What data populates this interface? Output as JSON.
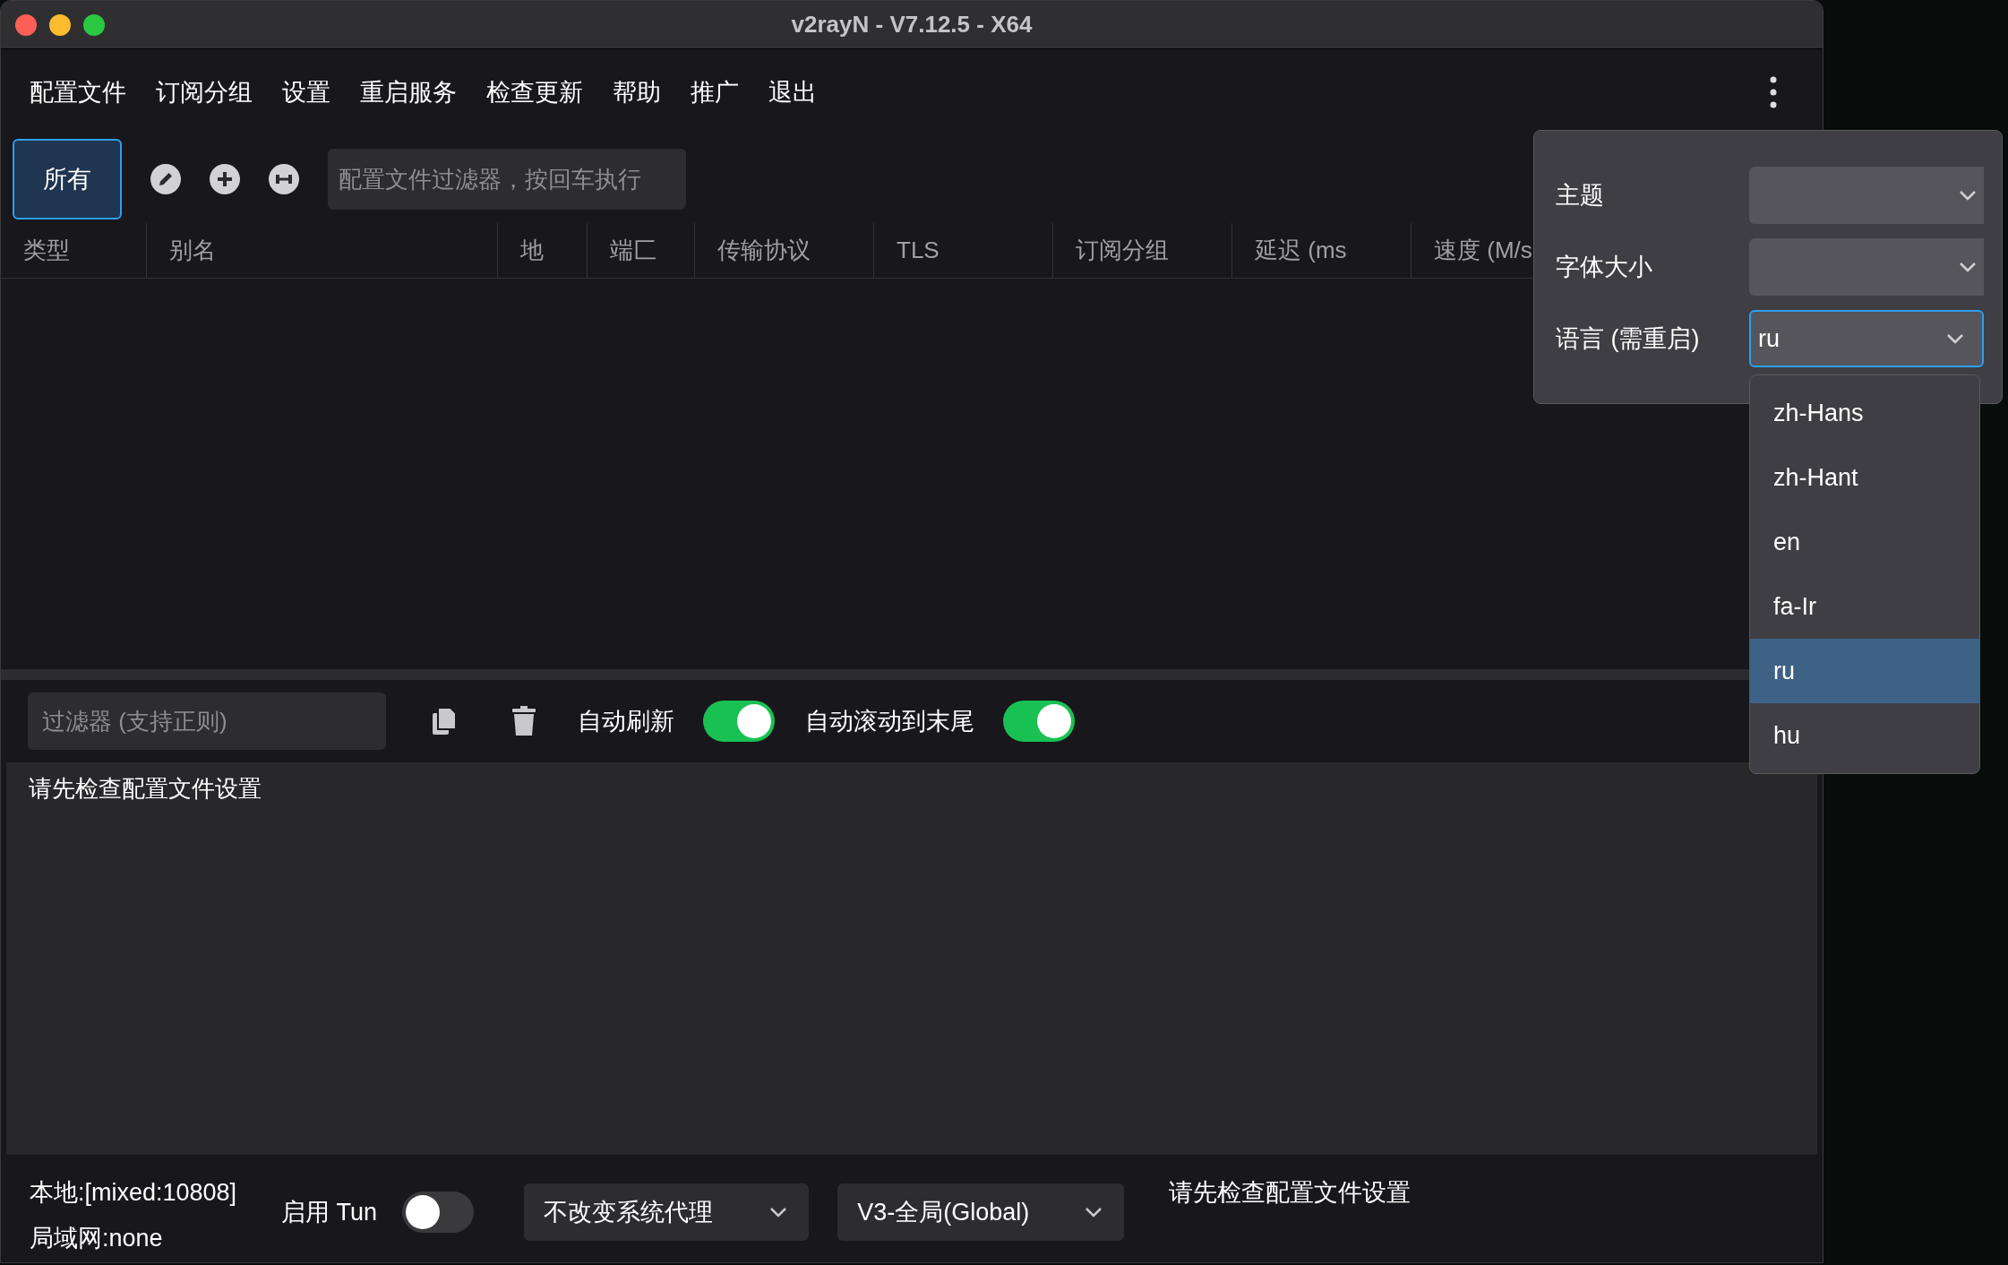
{
  "window": {
    "title": "v2rayN - V7.12.5 - X64"
  },
  "menu": [
    "配置文件",
    "订阅分组",
    "设置",
    "重启服务",
    "检查更新",
    "帮助",
    "推广",
    "退出"
  ],
  "toolbar": {
    "groups": [
      {
        "label": "所有",
        "selected": true
      }
    ],
    "filter": {
      "placeholder": "配置文件过滤器，按回车执行"
    }
  },
  "table": {
    "columns": [
      "类型",
      "别名",
      "地",
      "端匚",
      "传输协议",
      "TLS",
      "订阅分组",
      "延迟 (ms",
      "速度 (M/s"
    ]
  },
  "log_toolbar": {
    "filter": {
      "placeholder": "过滤器 (支持正则)"
    },
    "toggles": [
      {
        "label": "自动刷新",
        "on": true
      },
      {
        "label": "自动滚动到末尾",
        "on": true
      }
    ]
  },
  "log": {
    "text": "请先检查配置文件设置"
  },
  "status_bar": {
    "local": "本地:[mixed:10808]",
    "lan": "局域网:none",
    "tun": {
      "label": "启用 Tun",
      "on": false
    },
    "selects": [
      "不改变系统代理",
      "V3-全局(Global)"
    ],
    "message": "请先检查配置文件设置"
  },
  "settings_popup": {
    "rows": [
      {
        "label": "主题",
        "value": "",
        "focused": false
      },
      {
        "label": "字体大小",
        "value": "",
        "focused": false
      },
      {
        "label": "语言 (需重启)",
        "value": "ru",
        "focused": true
      }
    ],
    "options": [
      {
        "label": "zh-Hans",
        "selected": false
      },
      {
        "label": "zh-Hant",
        "selected": false
      },
      {
        "label": "en",
        "selected": false
      },
      {
        "label": "fa-Ir",
        "selected": false
      },
      {
        "label": "ru",
        "selected": true
      },
      {
        "label": "hu",
        "selected": false
      }
    ]
  }
}
